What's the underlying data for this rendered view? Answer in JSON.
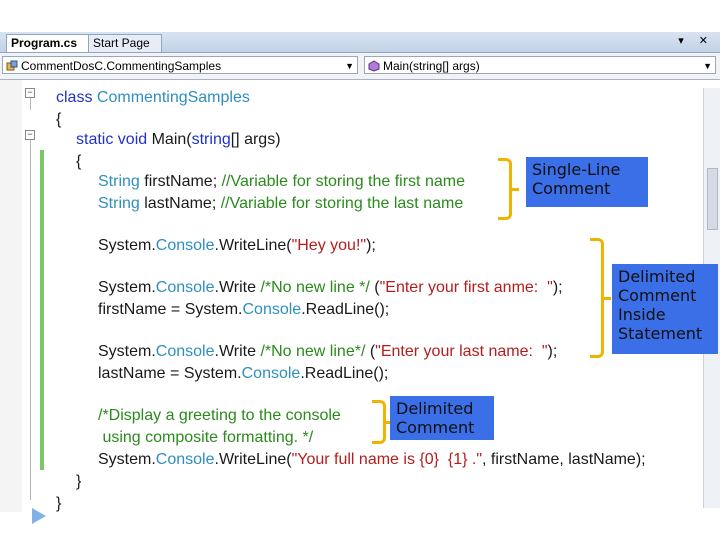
{
  "tabs": {
    "active": "Program.cs",
    "inactive": "Start Page",
    "controls": "▾ ✕"
  },
  "nav": {
    "type_combo": "CommentDosC.CommentingSamples",
    "member_combo": "Main(string[] args)"
  },
  "code_lines": [
    {
      "parts": [
        {
          "c": "kw",
          "t": "class "
        },
        {
          "c": "ty",
          "t": "CommentingSamples"
        }
      ]
    },
    {
      "parts": [
        {
          "c": "plain",
          "t": "{"
        }
      ]
    },
    {
      "parts": [
        {
          "c": "kw",
          "t": "static void "
        },
        {
          "c": "plain",
          "t": "Main("
        },
        {
          "c": "kw",
          "t": "string"
        },
        {
          "c": "plain",
          "t": "[] args)"
        }
      ]
    },
    {
      "parts": [
        {
          "c": "plain",
          "t": "{"
        }
      ]
    },
    {
      "parts": [
        {
          "c": "ty",
          "t": "String "
        },
        {
          "c": "plain",
          "t": "firstName; "
        },
        {
          "c": "cm",
          "t": "//Variable for storing the first name"
        }
      ]
    },
    {
      "parts": [
        {
          "c": "ty",
          "t": "String "
        },
        {
          "c": "plain",
          "t": "lastName; "
        },
        {
          "c": "cm",
          "t": "//Variable for storing the last name"
        }
      ]
    },
    {
      "parts": []
    },
    {
      "parts": [
        {
          "c": "plain",
          "t": "System."
        },
        {
          "c": "ty",
          "t": "Console"
        },
        {
          "c": "plain",
          "t": ".WriteLine("
        },
        {
          "c": "st",
          "t": "\"Hey you!\""
        },
        {
          "c": "plain",
          "t": ");"
        }
      ]
    },
    {
      "parts": []
    },
    {
      "parts": [
        {
          "c": "plain",
          "t": "System."
        },
        {
          "c": "ty",
          "t": "Console"
        },
        {
          "c": "plain",
          "t": ".Write "
        },
        {
          "c": "cm",
          "t": "/*No new line */"
        },
        {
          "c": "plain",
          "t": " ("
        },
        {
          "c": "st",
          "t": "\"Enter your first anme:  \""
        },
        {
          "c": "plain",
          "t": ");"
        }
      ]
    },
    {
      "parts": [
        {
          "c": "plain",
          "t": "firstName = System."
        },
        {
          "c": "ty",
          "t": "Console"
        },
        {
          "c": "plain",
          "t": ".ReadLine();"
        }
      ]
    },
    {
      "parts": []
    },
    {
      "parts": [
        {
          "c": "plain",
          "t": "System."
        },
        {
          "c": "ty",
          "t": "Console"
        },
        {
          "c": "plain",
          "t": ".Write "
        },
        {
          "c": "cm",
          "t": "/*No new line*/"
        },
        {
          "c": "plain",
          "t": " ("
        },
        {
          "c": "st",
          "t": "\"Enter your last name:  \""
        },
        {
          "c": "plain",
          "t": ");"
        }
      ]
    },
    {
      "parts": [
        {
          "c": "plain",
          "t": "lastName = System."
        },
        {
          "c": "ty",
          "t": "Console"
        },
        {
          "c": "plain",
          "t": ".ReadLine();"
        }
      ]
    },
    {
      "parts": []
    },
    {
      "parts": [
        {
          "c": "cm",
          "t": "/*Display a greeting to the console"
        }
      ]
    },
    {
      "parts": [
        {
          "c": "cm",
          "t": " using composite formatting. */"
        }
      ]
    },
    {
      "parts": [
        {
          "c": "plain",
          "t": "System."
        },
        {
          "c": "ty",
          "t": "Console"
        },
        {
          "c": "plain",
          "t": ".WriteLine("
        },
        {
          "c": "st",
          "t": "\"Your full name is {0}  {1} .\""
        },
        {
          "c": "plain",
          "t": ", firstName, lastName);"
        }
      ]
    },
    {
      "parts": [
        {
          "c": "plain",
          "t": "}"
        }
      ]
    },
    {
      "parts": [
        {
          "c": "plain",
          "t": "}"
        }
      ]
    }
  ],
  "callouts": {
    "single_line": "Single-Line\nComment",
    "delimited_inside": "Delimited\nComment\nInside\nStatement",
    "delimited": "Delimited\nComment"
  },
  "colors": {
    "keyword": "#1f33c9",
    "type": "#2f8fc0",
    "string": "#b51d1d",
    "comment": "#2a8a1c",
    "callout_bg": "#3b6fe8",
    "bracket": "#f0b400"
  }
}
